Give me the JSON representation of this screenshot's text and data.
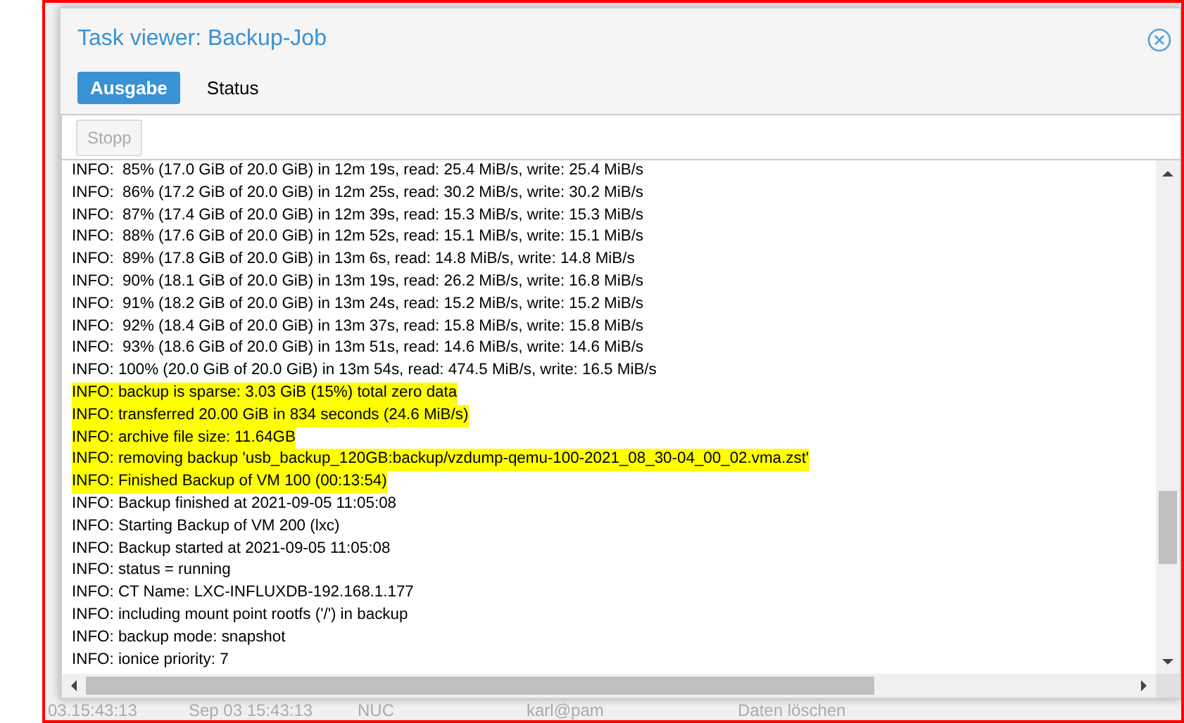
{
  "window": {
    "title": "Task viewer: Backup-Job"
  },
  "tabs": [
    {
      "label": "Ausgabe",
      "selected": true
    },
    {
      "label": "Status",
      "selected": false
    }
  ],
  "toolbar": {
    "stop_button": {
      "label": "Stopp",
      "disabled": true
    }
  },
  "log": [
    {
      "text": "INFO:  85% (17.0 GiB of 20.0 GiB) in 12m 19s, read: 25.4 MiB/s, write: 25.4 MiB/s",
      "highlighted": false
    },
    {
      "text": "INFO:  86% (17.2 GiB of 20.0 GiB) in 12m 25s, read: 30.2 MiB/s, write: 30.2 MiB/s",
      "highlighted": false
    },
    {
      "text": "INFO:  87% (17.4 GiB of 20.0 GiB) in 12m 39s, read: 15.3 MiB/s, write: 15.3 MiB/s",
      "highlighted": false
    },
    {
      "text": "INFO:  88% (17.6 GiB of 20.0 GiB) in 12m 52s, read: 15.1 MiB/s, write: 15.1 MiB/s",
      "highlighted": false
    },
    {
      "text": "INFO:  89% (17.8 GiB of 20.0 GiB) in 13m 6s, read: 14.8 MiB/s, write: 14.8 MiB/s",
      "highlighted": false
    },
    {
      "text": "INFO:  90% (18.1 GiB of 20.0 GiB) in 13m 19s, read: 26.2 MiB/s, write: 16.8 MiB/s",
      "highlighted": false
    },
    {
      "text": "INFO:  91% (18.2 GiB of 20.0 GiB) in 13m 24s, read: 15.2 MiB/s, write: 15.2 MiB/s",
      "highlighted": false
    },
    {
      "text": "INFO:  92% (18.4 GiB of 20.0 GiB) in 13m 37s, read: 15.8 MiB/s, write: 15.8 MiB/s",
      "highlighted": false
    },
    {
      "text": "INFO:  93% (18.6 GiB of 20.0 GiB) in 13m 51s, read: 14.6 MiB/s, write: 14.6 MiB/s",
      "highlighted": false
    },
    {
      "text": "INFO: 100% (20.0 GiB of 20.0 GiB) in 13m 54s, read: 474.5 MiB/s, write: 16.5 MiB/s",
      "highlighted": false
    },
    {
      "text": "INFO: backup is sparse: 3.03 GiB (15%) total zero data",
      "highlighted": true
    },
    {
      "text": "INFO: transferred 20.00 GiB in 834 seconds (24.6 MiB/s)",
      "highlighted": true
    },
    {
      "text": "INFO: archive file size: 11.64GB",
      "highlighted": true
    },
    {
      "text": "INFO: removing backup 'usb_backup_120GB:backup/vzdump-qemu-100-2021_08_30-04_00_02.vma.zst'",
      "highlighted": true
    },
    {
      "text": "INFO: Finished Backup of VM 100 (00:13:54)",
      "highlighted": true
    },
    {
      "text": "INFO: Backup finished at 2021-09-05 11:05:08",
      "highlighted": false
    },
    {
      "text": "INFO: Starting Backup of VM 200 (lxc)",
      "highlighted": false
    },
    {
      "text": "INFO: Backup started at 2021-09-05 11:05:08",
      "highlighted": false
    },
    {
      "text": "INFO: status = running",
      "highlighted": false
    },
    {
      "text": "INFO: CT Name: LXC-INFLUXDB-192.168.1.177",
      "highlighted": false
    },
    {
      "text": "INFO: including mount point rootfs ('/') in backup",
      "highlighted": false
    },
    {
      "text": "INFO: backup mode: snapshot",
      "highlighted": false
    },
    {
      "text": "INFO: ionice priority: 7",
      "highlighted": false
    }
  ],
  "background_row": [
    "03.15:43:13",
    "Sep 03 15:43:13",
    "NUC",
    "karl@pam",
    "Daten löschen"
  ]
}
